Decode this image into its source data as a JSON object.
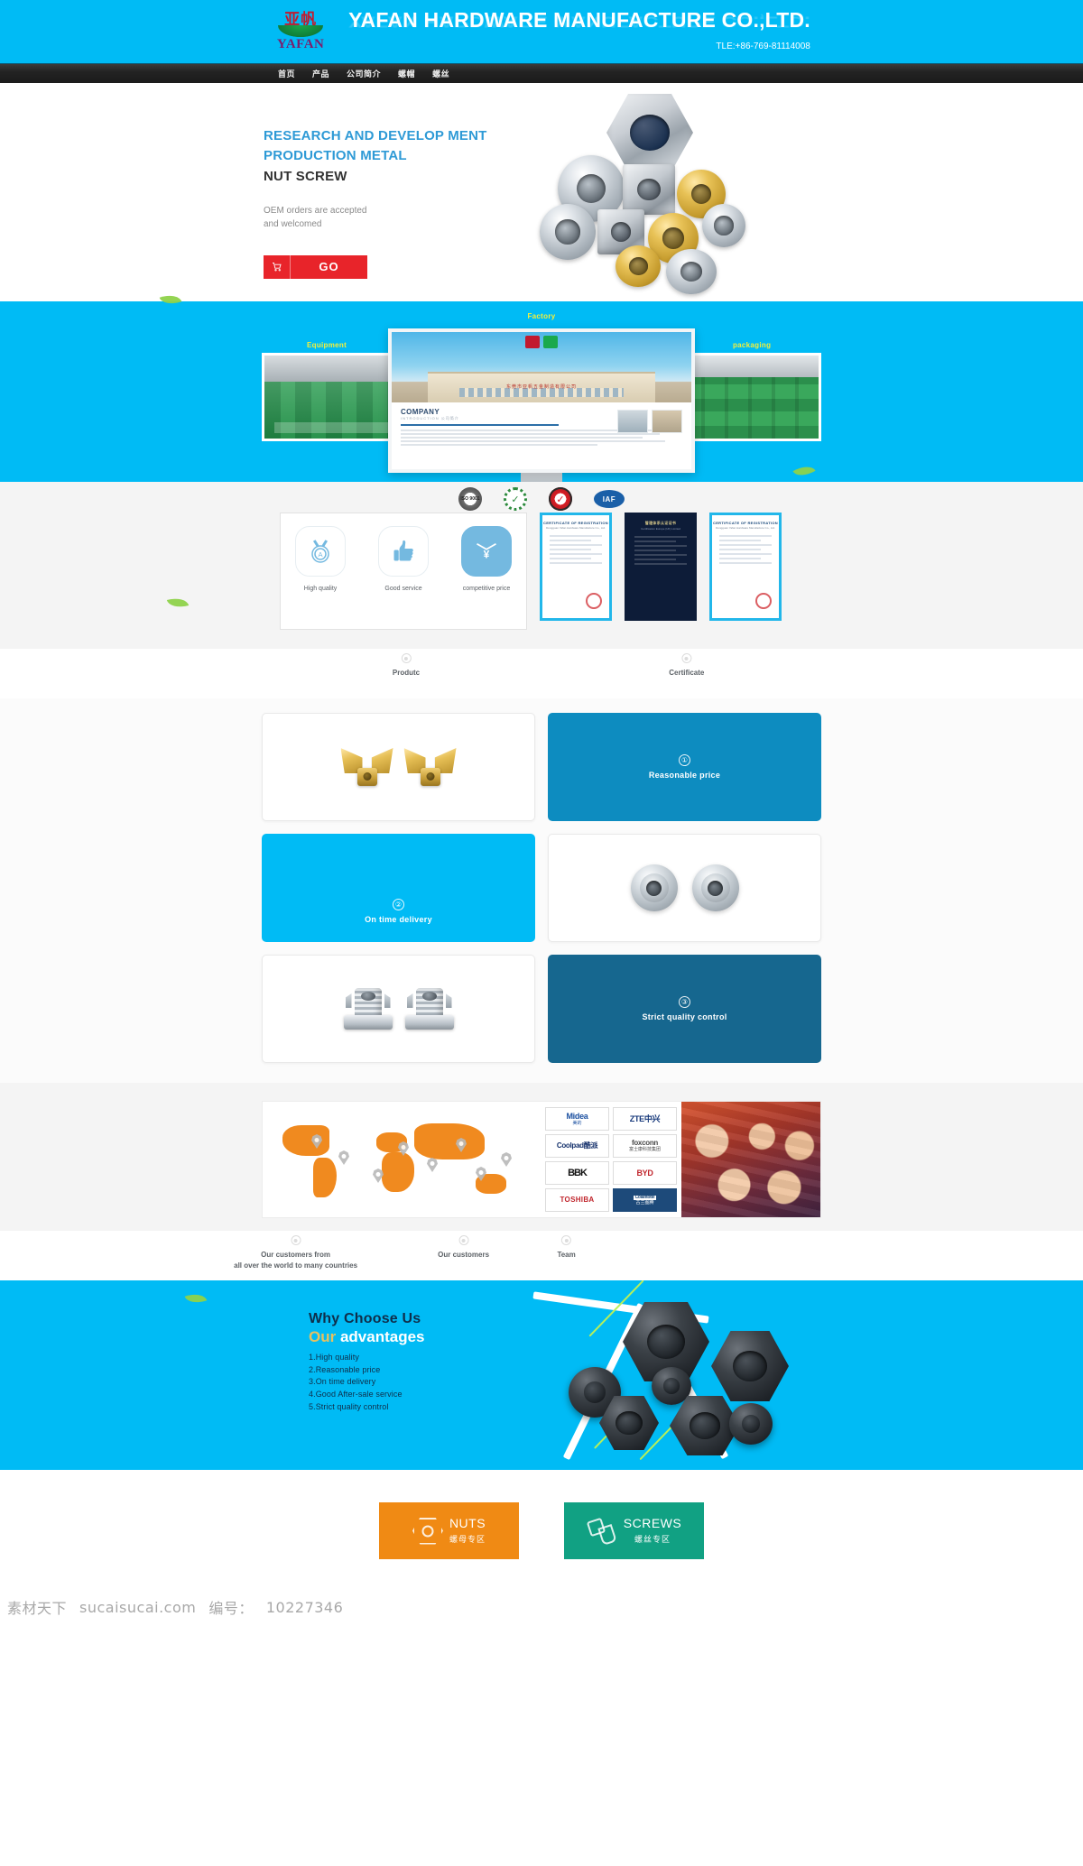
{
  "header": {
    "logo_cn": "亚帆",
    "logo_en": "YAFAN",
    "company_name": "YAFAN HARDWARE MANUFACTURE CO.,LTD.",
    "tel": "TLE:+86-769-81114008"
  },
  "nav": {
    "items": [
      {
        "label": "首页"
      },
      {
        "label": "产品"
      },
      {
        "label": "公司简介"
      },
      {
        "label": "螺帽"
      },
      {
        "label": "螺丝"
      }
    ]
  },
  "hero": {
    "headline_line1": "RESEARCH AND DEVELOP MENT",
    "headline_line2": "PRODUCTION METAL",
    "headline_line3": "NUT SCREW",
    "sub_line1": "OEM orders are accepted",
    "sub_line2": "and welcomed",
    "cta_label": "GO",
    "cart_icon": "cart-icon"
  },
  "factory": {
    "label_center": "Factory",
    "label_left": "Equipment",
    "label_right": "packaging",
    "monitor": {
      "site_heading": "COMPANY",
      "site_subheading": "INTRODUCTION  公司简介",
      "banner_text": "东莞市亚帆五金制造有限公司"
    }
  },
  "trust": {
    "badges": [
      {
        "name": "iso-badge",
        "label": "ISO 9001"
      },
      {
        "name": "wreath-certificate-badge",
        "label": "✓"
      },
      {
        "name": "red-check-badge",
        "label": "✓"
      },
      {
        "name": "iaf-badge",
        "label": "IAF"
      }
    ],
    "items": [
      {
        "icon": "quality-medal-icon",
        "glyph": "Ⓐ",
        "label": "High quality"
      },
      {
        "icon": "thumbs-up-icon",
        "glyph": "👍",
        "label": "Good service"
      },
      {
        "icon": "money-envelope-icon",
        "glyph": "¥",
        "label": "competitive price"
      }
    ],
    "certificates": [
      {
        "title": "CERTIFICATE OF REGISTRATION",
        "subtitle": "Dongguan Yafan Hardware Manufacture Co., Ltd."
      },
      {
        "title": "管理体系认证证书",
        "subtitle": "Certification Europe (UK) Limited"
      },
      {
        "title": "CERTIFICATE OF REGISTRATION",
        "subtitle": "Dongguan Yafan Hardware Manufacture Co., Ltd."
      }
    ]
  },
  "captions_row_1": [
    {
      "label": "Produtc",
      "left_pct": 37.5
    },
    {
      "label": "Certificate",
      "left_pct": 63.4
    }
  ],
  "product_grid": [
    {
      "type": "photo",
      "art": "wing-nut",
      "name": "product-card-wing-nut"
    },
    {
      "type": "blue",
      "num": "①",
      "title": "Reasonable price",
      "name": "feature-card-reasonable-price"
    },
    {
      "type": "cyan",
      "num": "②",
      "title": "On time delivery",
      "name": "feature-card-on-time-delivery"
    },
    {
      "type": "photo",
      "art": "flange-nut",
      "name": "product-card-flange-nut"
    },
    {
      "type": "photo",
      "art": "tee-nut",
      "name": "product-card-tee-nut"
    },
    {
      "type": "navy",
      "num": "③",
      "title": "Strict quality control",
      "name": "feature-card-strict-quality-control"
    }
  ],
  "customers": {
    "brand_logos": [
      {
        "main": "Midea",
        "cn": "美的",
        "cls": "lg-midea"
      },
      {
        "main": "ZTE中兴",
        "cn": "",
        "cls": "lg-zte"
      },
      {
        "main": "Coolpad酷派",
        "cn": "",
        "cls": "lg-coolpad"
      },
      {
        "main": "foxconn",
        "cn": "富士康科技集团",
        "cls": "lg-foxconn"
      },
      {
        "main": "BBK",
        "cn": "",
        "cls": "lg-bbk"
      },
      {
        "main": "BYD",
        "cn": "",
        "cls": "lg-byd"
      },
      {
        "main": "TOSHIBA",
        "cn": "",
        "cls": "lg-toshiba"
      },
      {
        "main": "Colantotte",
        "cn": "古兰图腾",
        "cls": "lg-colantotte"
      }
    ]
  },
  "captions_row_2": [
    {
      "line1": "Our customers from",
      "line2": "all over the world to many countries",
      "left_pct": 27.3
    },
    {
      "line1": "Our customers",
      "line2": "",
      "left_pct": 42.8
    },
    {
      "line1": "Team",
      "line2": "",
      "left_pct": 52.3
    }
  ],
  "why": {
    "title": "Why Choose Us",
    "subtitle_accent": "Our",
    "subtitle_rest": "advantages",
    "advantages": [
      "1.High quality",
      "2.Reasonable price",
      "3.On time delivery",
      "4.Good After-sale service",
      "5.Strict quality control"
    ]
  },
  "bottom_buttons": [
    {
      "en": "NUTS",
      "cn": "螺母专区",
      "color": "#f08a14",
      "icon": "nut-icon",
      "cls": "orange"
    },
    {
      "en": "SCREWS",
      "cn": "螺丝专区",
      "color": "#11a183",
      "icon": "screw-icon",
      "cls": "green"
    }
  ],
  "watermark": {
    "site_cn": "素材天下",
    "site_url": "sucaisucai.com",
    "id_label": "编号：",
    "id_value": "10227346"
  },
  "colors": {
    "brand_cyan": "#00bbf5",
    "nav_dark": "#1f1f1f",
    "cta_red": "#e8242a",
    "card_blue": "#0d8cc0",
    "card_navy": "#16678f",
    "orange": "#f08a14",
    "green": "#11a183",
    "label_yellow": "#f4ef3a"
  }
}
